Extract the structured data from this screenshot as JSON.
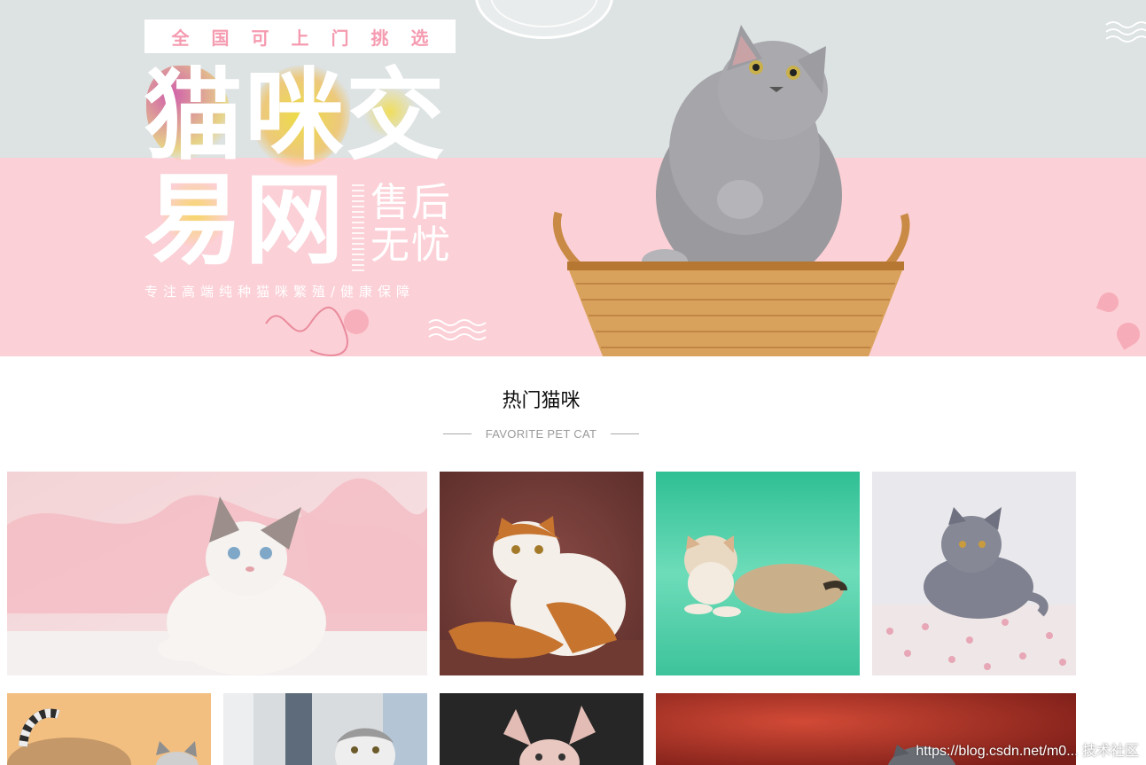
{
  "banner": {
    "select_text": "全国可上门挑选",
    "title_line1": "猫咪交",
    "title_line2": "易网",
    "after_sale_line1": "售后",
    "after_sale_line2": "无忧",
    "slogan": "专注高端纯种猫咪繁殖/健康保障",
    "colors": {
      "top": "#dde2e2",
      "bottom": "#fcd0d7",
      "accent": "#f59bb0"
    }
  },
  "section": {
    "title": "热门猫咪",
    "subtitle": "FAVORITE PET CAT"
  },
  "gallery": {
    "row1": [
      {
        "name": "white-ragdoll-kitten-photo"
      },
      {
        "name": "orange-white-exotic-cat-photo"
      },
      {
        "name": "golden-british-shorthair-photo"
      },
      {
        "name": "grey-british-shorthair-photo"
      }
    ],
    "row2": [
      {
        "name": "tabby-kitten-photo"
      },
      {
        "name": "scottish-fold-kitten-photo"
      },
      {
        "name": "sphynx-kitten-photo"
      },
      {
        "name": "grey-cat-red-background-photo"
      }
    ]
  },
  "watermark": "https://blog.csdn.net/m0... 技术社区"
}
